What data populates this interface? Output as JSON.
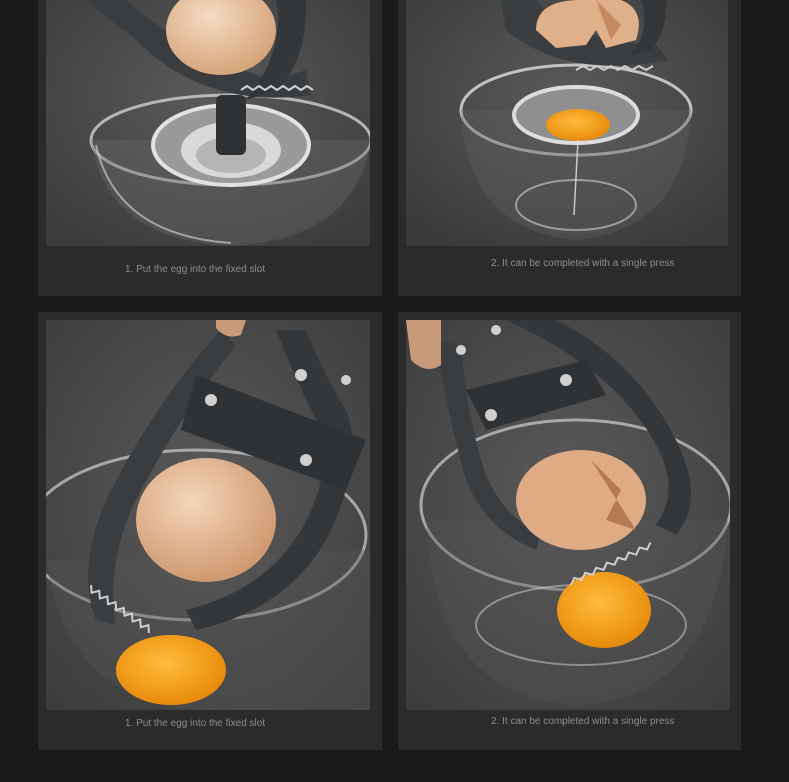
{
  "steps": [
    {
      "caption": "1. Put the egg into the fixed slot"
    },
    {
      "caption": "2. It can be completed with a single press"
    },
    {
      "caption": "1. Put the egg into the fixed slot"
    },
    {
      "caption": "2. It can be completed with a single press"
    }
  ],
  "colors": {
    "page_background": "#1a1a1a",
    "card_background": "#2b2b2b",
    "caption_text": "#8d8d8d",
    "tool_body": "#3a3d40",
    "eggshell": "#e6bf9d",
    "yolk": "#f5a21a"
  }
}
